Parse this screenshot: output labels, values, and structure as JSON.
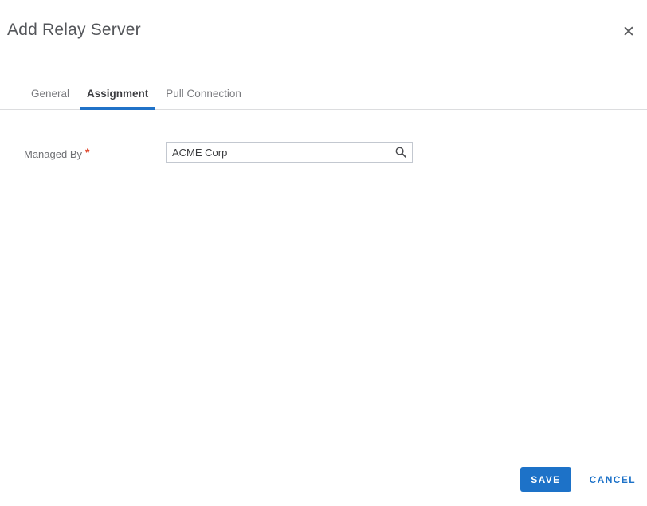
{
  "dialog": {
    "title": "Add Relay Server"
  },
  "icons": {
    "close": "✕",
    "search": "magnifier"
  },
  "tabs": {
    "items": [
      {
        "label": "General",
        "active": false
      },
      {
        "label": "Assignment",
        "active": true
      },
      {
        "label": "Pull Connection",
        "active": false
      }
    ]
  },
  "form": {
    "managed_by": {
      "label": "Managed By",
      "required_marker": "*",
      "value": "ACME Corp"
    }
  },
  "footer": {
    "save_label": "SAVE",
    "cancel_label": "CANCEL"
  },
  "colors": {
    "accent_blue": "#1d72c8",
    "tab_underline": "#2072c8",
    "required_red": "#e0462c",
    "title_gray": "#54565a",
    "divider_gray": "#dcdddf"
  }
}
